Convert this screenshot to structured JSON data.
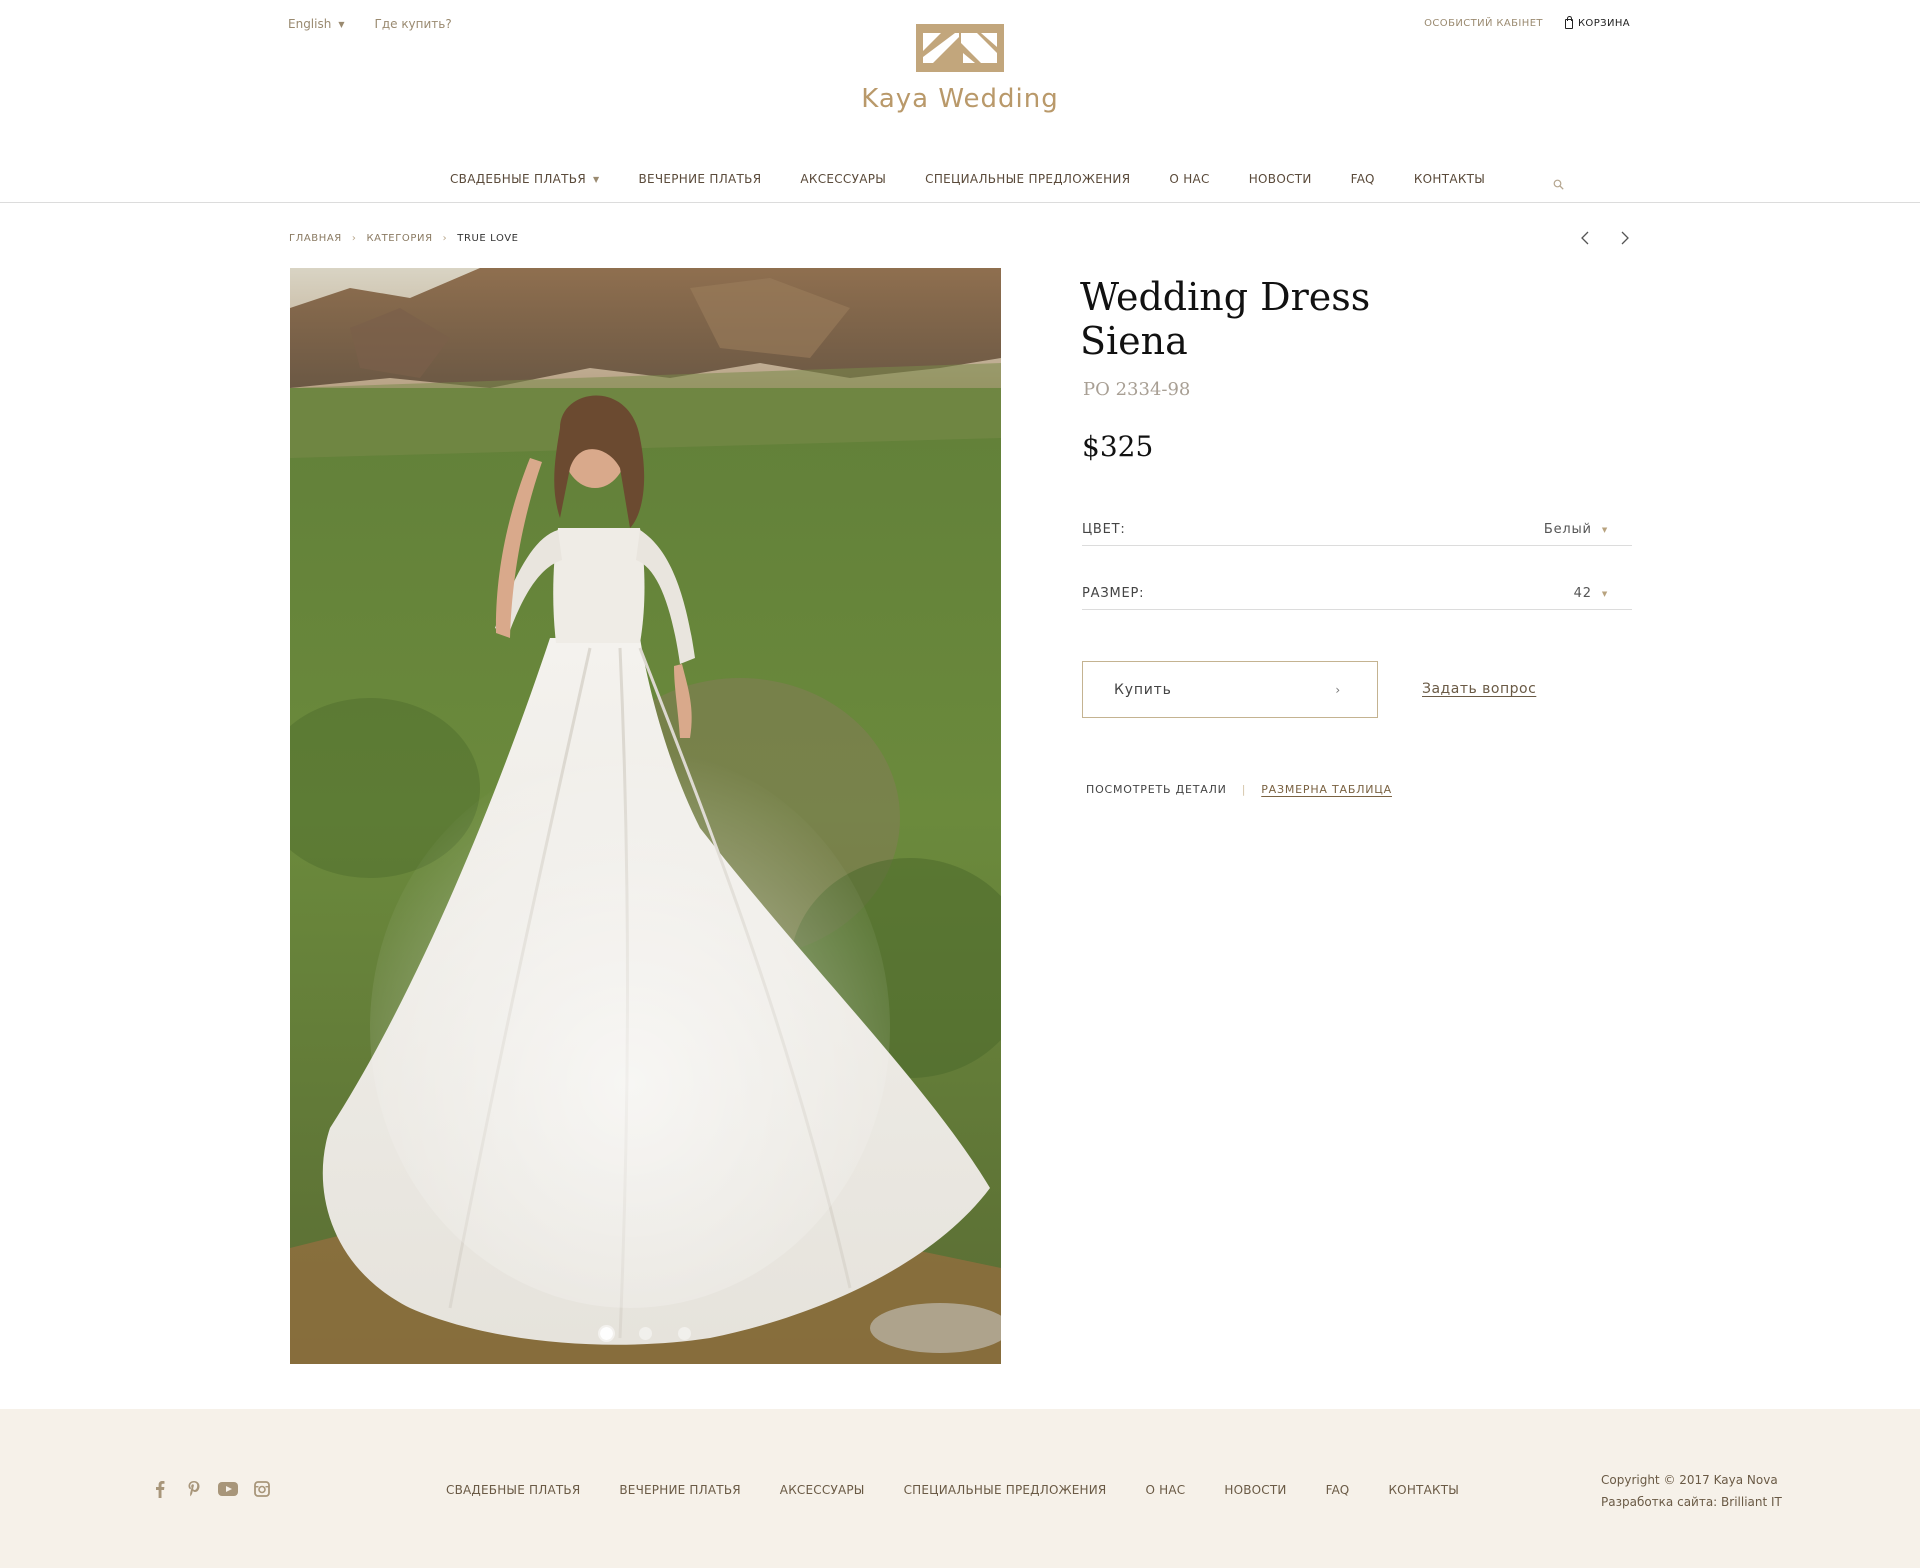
{
  "header": {
    "language": "English",
    "where_to_buy": "Где купить?",
    "account": "ОСОБИСТИЙ КАБІНЕТ",
    "cart": "КОРЗИНА",
    "brand": "Kaya Wedding"
  },
  "nav": {
    "items": [
      {
        "label": "СВАДЕБНЫЕ ПЛАТЬЯ",
        "has_dropdown": true
      },
      {
        "label": "ВЕЧЕРНИЕ ПЛАТЬЯ"
      },
      {
        "label": "АКСЕССУАРЫ"
      },
      {
        "label": "СПЕЦИАЛЬНЫЕ ПРЕДЛОЖЕНИЯ"
      },
      {
        "label": "О НАС"
      },
      {
        "label": "НОВОСТИ"
      },
      {
        "label": "FAQ"
      },
      {
        "label": "КОНТАКТЫ"
      }
    ]
  },
  "breadcrumb": {
    "items": [
      "ГЛАВНАЯ",
      "КАТЕГОРИЯ",
      "TRUE LOVE"
    ],
    "separator": "›"
  },
  "gallery": {
    "slides": 3,
    "active_slide": 1
  },
  "product": {
    "title_line1": "Wedding Dress",
    "title_line2": "Siena",
    "sku": "PO 2334-98",
    "price": "$325",
    "color_label": "ЦВЕТ:",
    "color_value": "Белый",
    "size_label": "РАЗМЕР:",
    "size_value": "42",
    "buy_label": "Купить",
    "ask_label": "Задать вопрос",
    "details_label": "ПОСМОТРЕТЬ ДЕТАЛИ",
    "size_table_label": "РАЗМЕРНА ТАБЛИЦА"
  },
  "footer": {
    "social": [
      "facebook-icon",
      "pinterest-icon",
      "youtube-icon",
      "instagram-icon"
    ],
    "nav": [
      "СВАДЕБНЫЕ ПЛАТЬЯ",
      "ВЕЧЕРНИЕ ПЛАТЬЯ",
      "АКСЕССУАРЫ",
      "СПЕЦИАЛЬНЫЕ ПРЕДЛОЖЕНИЯ",
      "О НАС",
      "НОВОСТИ",
      "FAQ",
      "КОНТАКТЫ"
    ],
    "copyright": "Copyright © 2017 Kaya Nova",
    "developer": "Разработка сайта: Brilliant IT"
  },
  "colors": {
    "brand_gold": "#b9996a",
    "footer_bg": "#f6f1e9",
    "text_dark": "#111111"
  }
}
